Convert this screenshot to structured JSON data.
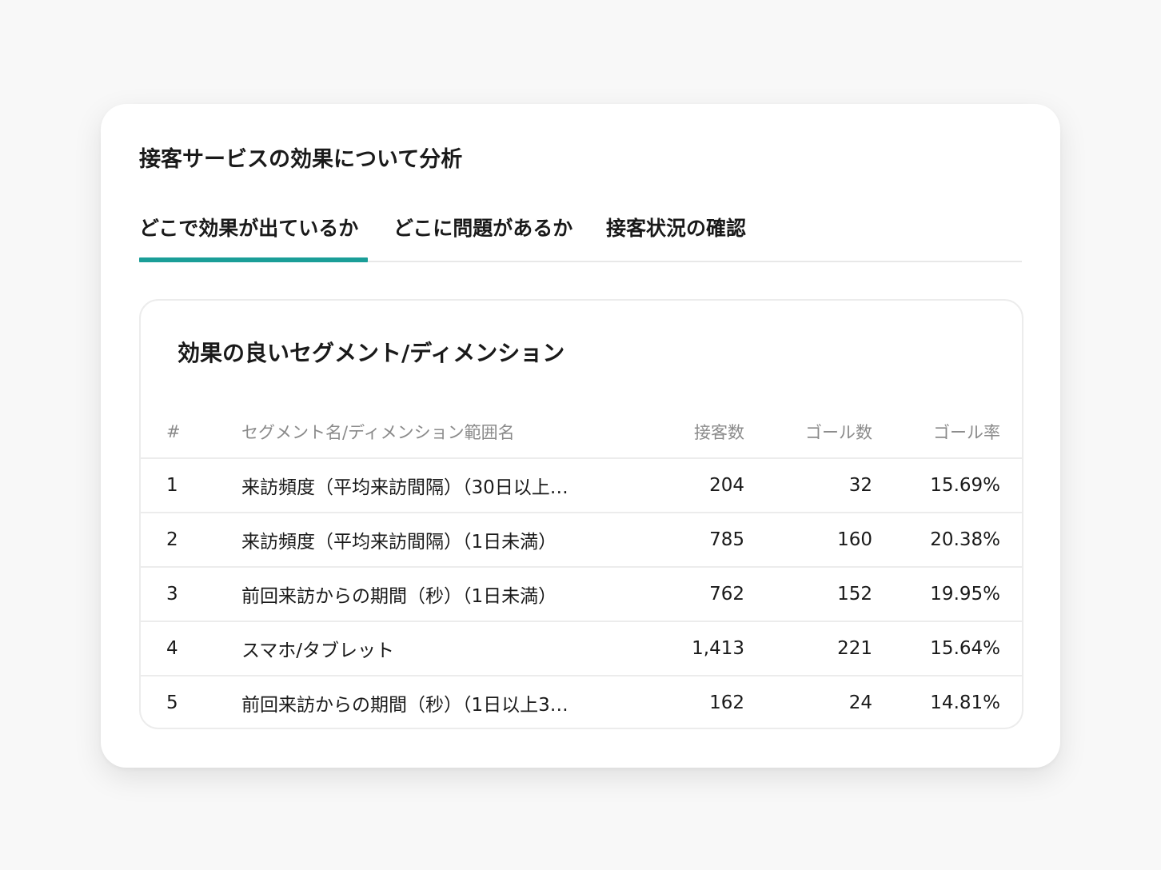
{
  "card": {
    "title": "接客サービスの効果について分析"
  },
  "tabs": [
    {
      "label": "どこで効果が出ているか",
      "active": true
    },
    {
      "label": "どこに問題があるか",
      "active": false
    },
    {
      "label": "接客状況の確認",
      "active": false
    }
  ],
  "panel": {
    "title": "効果の良いセグメント/ディメンション"
  },
  "table": {
    "headers": {
      "index": "#",
      "name": "セグメント名/ディメンション範囲名",
      "visits": "接客数",
      "goals": "ゴール数",
      "rate": "ゴール率"
    },
    "rows": [
      {
        "index": "1",
        "name": "来訪頻度（平均来訪間隔）（30日以上…",
        "visits": "204",
        "goals": "32",
        "rate": "15.69%"
      },
      {
        "index": "2",
        "name": "来訪頻度（平均来訪間隔）（1日未満）",
        "visits": "785",
        "goals": "160",
        "rate": "20.38%"
      },
      {
        "index": "3",
        "name": "前回来訪からの期間（秒）（1日未満）",
        "visits": "762",
        "goals": "152",
        "rate": "19.95%"
      },
      {
        "index": "4",
        "name": "スマホ/タブレット",
        "visits": "1,413",
        "goals": "221",
        "rate": "15.64%"
      },
      {
        "index": "5",
        "name": "前回来訪からの期間（秒）（1日以上3…",
        "visits": "162",
        "goals": "24",
        "rate": "14.81%"
      }
    ]
  },
  "colors": {
    "accent": "#1a9e98",
    "background": "#f8f8f8",
    "card": "#ffffff",
    "header_text": "#8a8a8a",
    "border": "#ececec"
  }
}
